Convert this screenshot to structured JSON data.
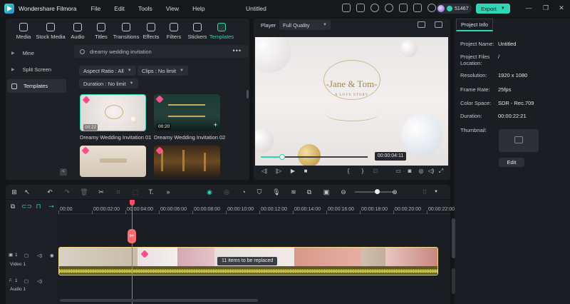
{
  "titlebar": {
    "app_name": "Wondershare Filmora",
    "menus": [
      "File",
      "Edit",
      "Tools",
      "View",
      "Help"
    ],
    "doc_title": "Untitled",
    "credits": "51467",
    "export_label": "Export"
  },
  "media_tabs": [
    "Media",
    "Stock Media",
    "Audio",
    "Titles",
    "Transitions",
    "Effects",
    "Filters",
    "Stickers",
    "Templates"
  ],
  "sidebar": {
    "items": [
      {
        "label": "Mine"
      },
      {
        "label": "Split Screen"
      },
      {
        "label": "Templates"
      }
    ],
    "collapse_glyph": "<"
  },
  "search": {
    "value": "dreamy wedding invitation",
    "more": "•••"
  },
  "filters": {
    "aspect": "Aspect Ratio : All",
    "clips": "Clips : No limit",
    "duration": "Duration : No limit"
  },
  "templates": [
    {
      "label": "Dreamy Wedding Invitation 01",
      "duration": "00:22"
    },
    {
      "label": "Dreamy Wedding Invitation 02",
      "duration": "00:20"
    }
  ],
  "player": {
    "label": "Player",
    "quality": "Full Quality",
    "current_time": "00:00:04:11",
    "total_time": "00:00:22:21",
    "preview_title": "-Jane & Tom-",
    "preview_subtitle": "A LOVE STORY",
    "progress": 0.2
  },
  "project_info": {
    "tab": "Project Info",
    "rows": [
      {
        "key": "Project Name:",
        "value": "Untitled"
      },
      {
        "key": "Project Files Location:",
        "value": "/"
      },
      {
        "key": "Resolution:",
        "value": "1920 x 1080"
      },
      {
        "key": "Frame Rate:",
        "value": "25fps"
      },
      {
        "key": "Color Space:",
        "value": "SDR - Rec.709"
      },
      {
        "key": "Duration:",
        "value": "00:00:22:21"
      },
      {
        "key": "Thumbnail:",
        "value": ""
      }
    ],
    "edit_label": "Edit"
  },
  "timeline": {
    "ruler": [
      "00:00",
      "00:00:02:00",
      "00:00:04:00",
      "00:00:06:00",
      "00:00:08:00",
      "00:00:10:00",
      "00:00:12:00",
      "00:00:14:00",
      "00:00:16:00",
      "00:00:18:00",
      "00:00:20:00",
      "00:00:22:00"
    ],
    "video_track": "Video 1",
    "audio_track": "Audio 1",
    "track_index": "1",
    "tooltip": "11 items to be replaced"
  },
  "colors": {
    "accent": "#2fd6b3",
    "playhead": "#ff4f5e",
    "template_gem": "#ff4f8b"
  }
}
